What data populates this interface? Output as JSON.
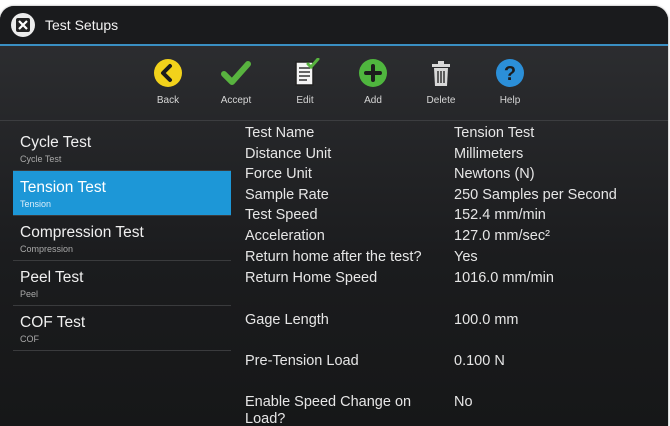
{
  "app": {
    "title": "Test Setups"
  },
  "toolbar": {
    "back_label": "Back",
    "accept_label": "Accept",
    "edit_label": "Edit",
    "add_label": "Add",
    "delete_label": "Delete",
    "help_label": "Help"
  },
  "colors": {
    "accent": "#1d97d7",
    "back_icon": "#f2d21b",
    "accept_icon": "#58b33f",
    "add_icon": "#4fb63e",
    "help_icon": "#2b8fd8"
  },
  "tests": [
    {
      "name": "Cycle Test",
      "type": "Cycle Test",
      "selected": false
    },
    {
      "name": "Tension Test",
      "type": "Tension",
      "selected": true
    },
    {
      "name": "Compression Test",
      "type": "Compression",
      "selected": false
    },
    {
      "name": "Peel Test",
      "type": "Peel",
      "selected": false
    },
    {
      "name": "COF Test",
      "type": "COF",
      "selected": false
    }
  ],
  "properties": [
    {
      "key": "Test Name",
      "value": "Tension Test"
    },
    {
      "key": "Distance Unit",
      "value": "Millimeters"
    },
    {
      "key": "Force Unit",
      "value": "Newtons (N)"
    },
    {
      "key": "Sample Rate",
      "value": "250 Samples per Second"
    },
    {
      "key": "Test Speed",
      "value": "152.4 mm/min"
    },
    {
      "key": "Acceleration",
      "value": "127.0 mm/sec²"
    },
    {
      "key": "Return home after the test?",
      "value": "Yes"
    },
    {
      "key": "Return Home Speed",
      "value": "1016.0 mm/min"
    },
    {
      "key": "Gage Length",
      "value": "100.0 mm"
    },
    {
      "key": "Pre-Tension Load",
      "value": "0.100 N"
    },
    {
      "key": "Enable Speed Change on Load?",
      "value": "No"
    }
  ]
}
